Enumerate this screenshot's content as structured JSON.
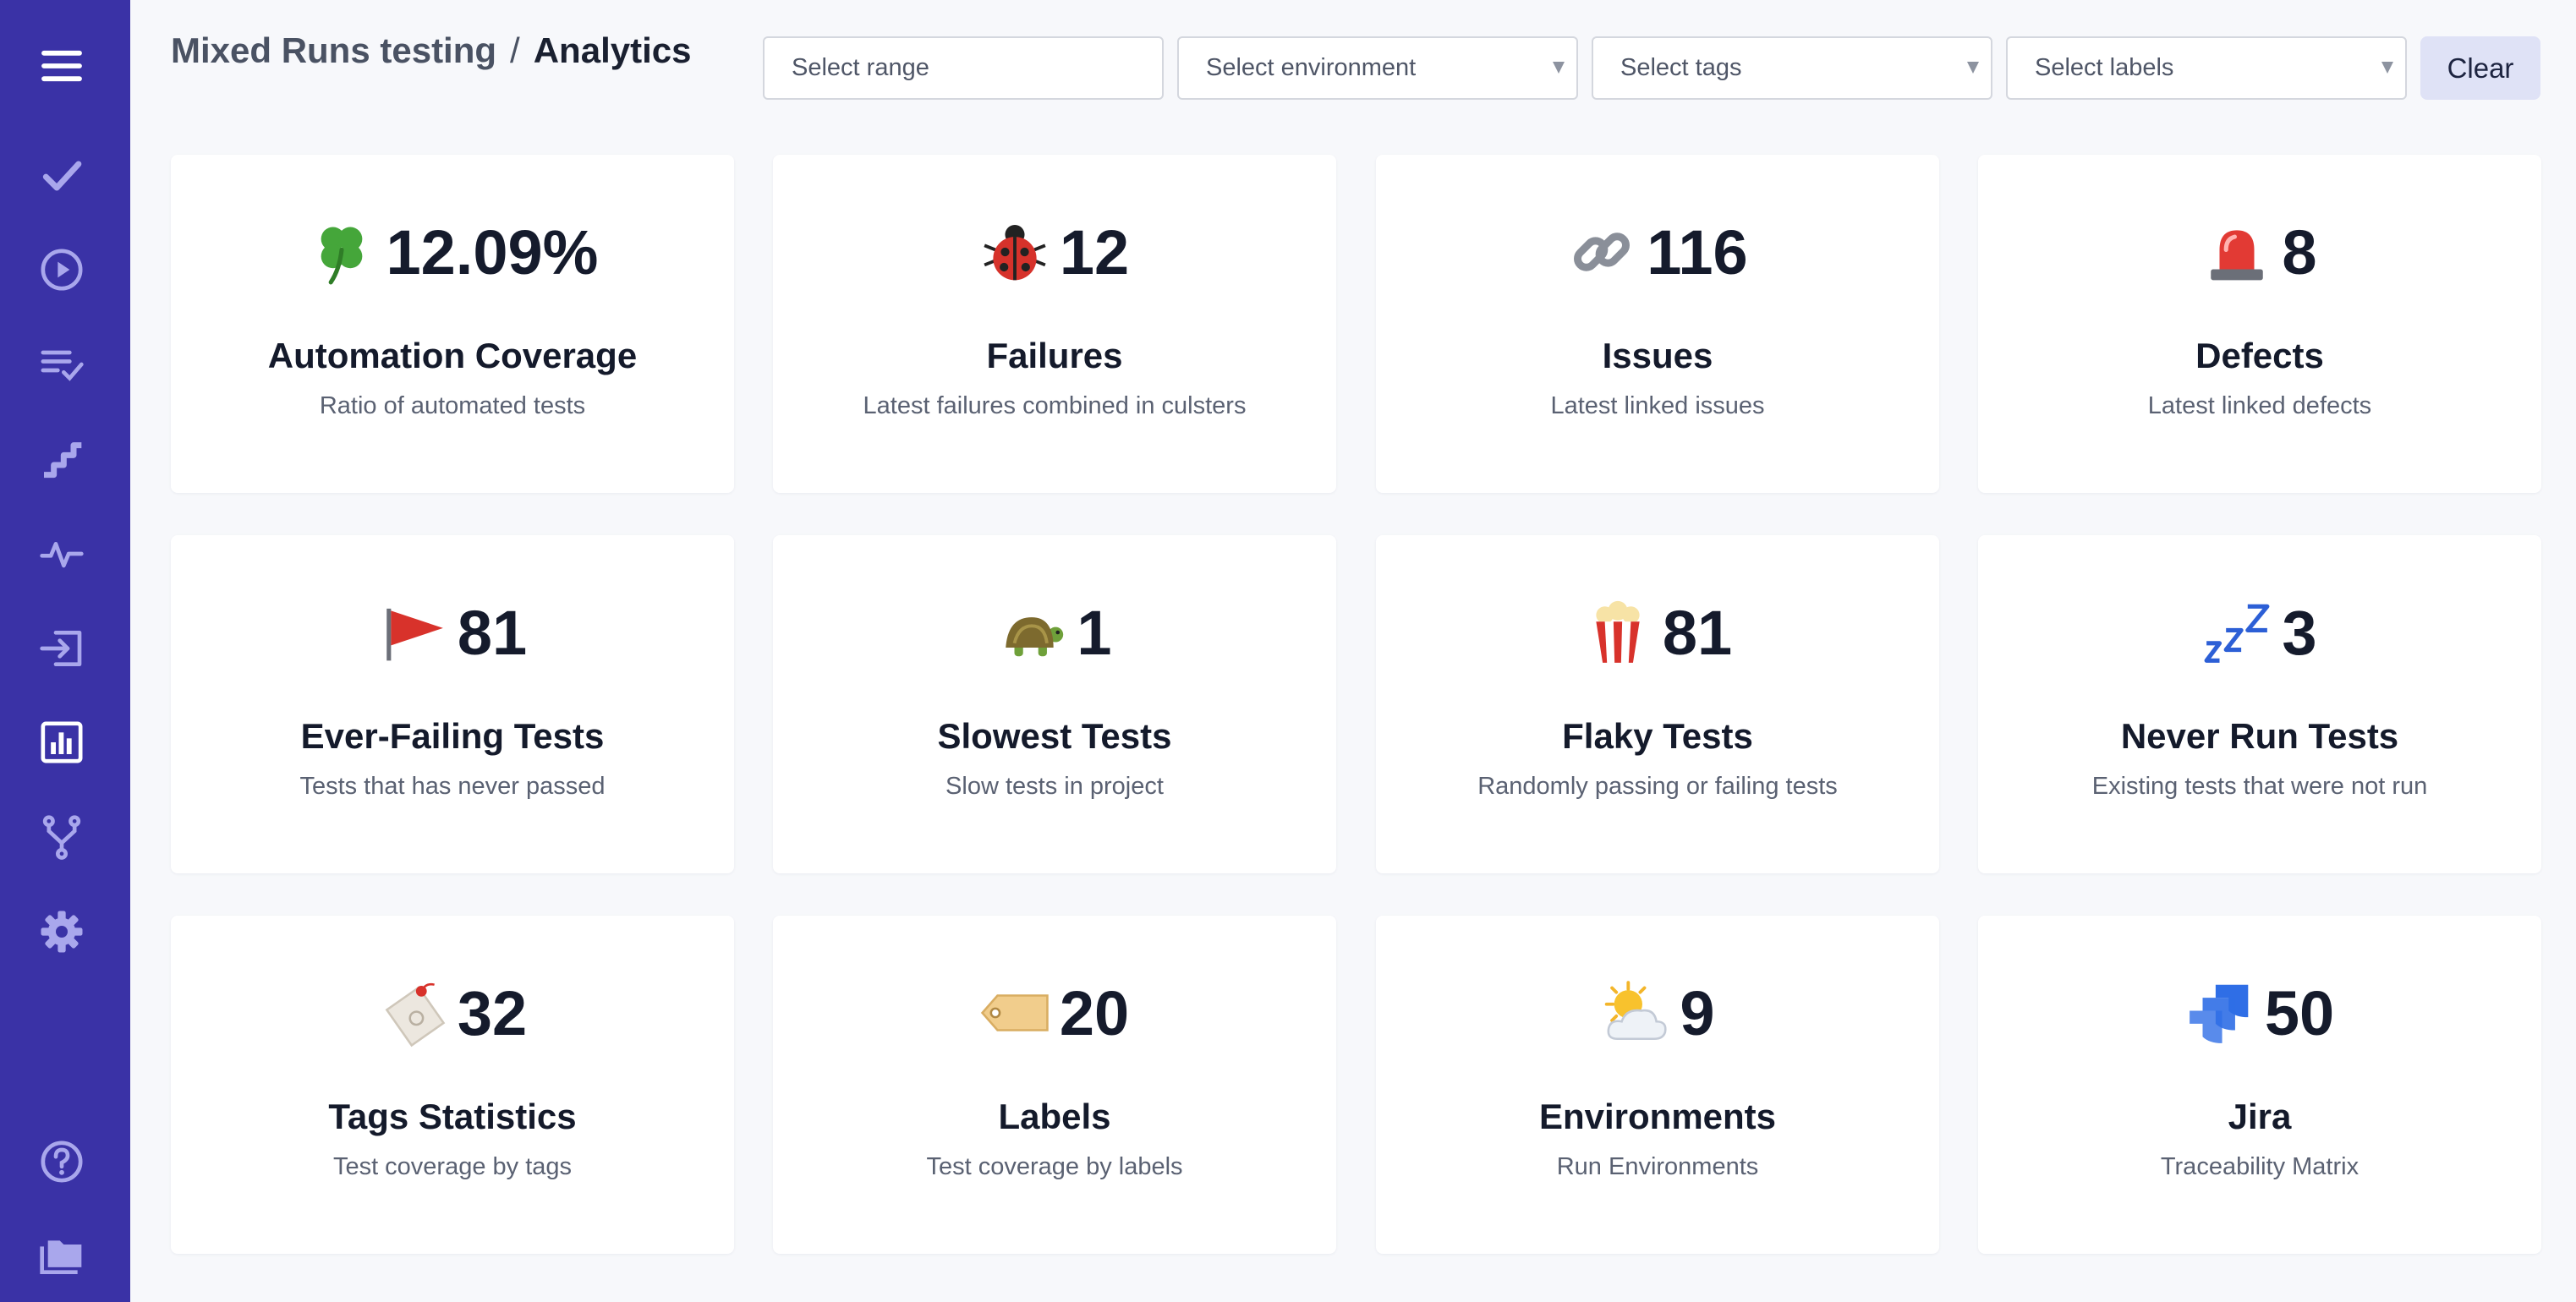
{
  "breadcrumb": {
    "project": "Mixed Runs testing",
    "separator": "/",
    "current": "Analytics"
  },
  "filters": {
    "range_placeholder": "Select range",
    "environment_placeholder": "Select environment",
    "tags_placeholder": "Select tags",
    "labels_placeholder": "Select labels",
    "clear_label": "Clear"
  },
  "sidebar": {
    "items": [
      {
        "icon": "menu-icon"
      },
      {
        "icon": "check-icon"
      },
      {
        "icon": "play-circle-icon"
      },
      {
        "icon": "list-check-icon"
      },
      {
        "icon": "steps-icon"
      },
      {
        "icon": "pulse-icon"
      },
      {
        "icon": "import-icon"
      },
      {
        "icon": "analytics-icon"
      },
      {
        "icon": "branch-icon"
      },
      {
        "icon": "settings-icon"
      },
      {
        "icon": "help-icon"
      },
      {
        "icon": "folder-icon"
      }
    ]
  },
  "cards": [
    {
      "emoji": "four-leaf-clover",
      "value": "12.09%",
      "title": "Automation Coverage",
      "desc": "Ratio of automated tests"
    },
    {
      "emoji": "ladybug",
      "value": "12",
      "title": "Failures",
      "desc": "Latest failures combined in culsters"
    },
    {
      "emoji": "link",
      "value": "116",
      "title": "Issues",
      "desc": "Latest linked issues"
    },
    {
      "emoji": "rotating-light",
      "value": "8",
      "title": "Defects",
      "desc": "Latest linked defects"
    },
    {
      "emoji": "triangular-flag",
      "value": "81",
      "title": "Ever-Failing Tests",
      "desc": "Tests that has never passed"
    },
    {
      "emoji": "turtle",
      "value": "1",
      "title": "Slowest Tests",
      "desc": "Slow tests in project"
    },
    {
      "emoji": "popcorn",
      "value": "81",
      "title": "Flaky Tests",
      "desc": "Randomly passing or failing tests"
    },
    {
      "emoji": "zzz",
      "value": "3",
      "title": "Never Run Tests",
      "desc": "Existing tests that were not run"
    },
    {
      "emoji": "tag-label",
      "value": "32",
      "title": "Tags Statistics",
      "desc": "Test coverage by tags"
    },
    {
      "emoji": "label-tag",
      "value": "20",
      "title": "Labels",
      "desc": "Test coverage by labels"
    },
    {
      "emoji": "sun-behind-cloud",
      "value": "9",
      "title": "Environments",
      "desc": "Run Environments"
    },
    {
      "emoji": "jira-logo",
      "value": "50",
      "title": "Jira",
      "desc": "Traceability Matrix"
    }
  ],
  "colors": {
    "sidebar": "#3a32a6",
    "sidebar_icon": "#a9a7ec",
    "background": "#f7f8fb",
    "clear_button": "#dfe2f6"
  }
}
